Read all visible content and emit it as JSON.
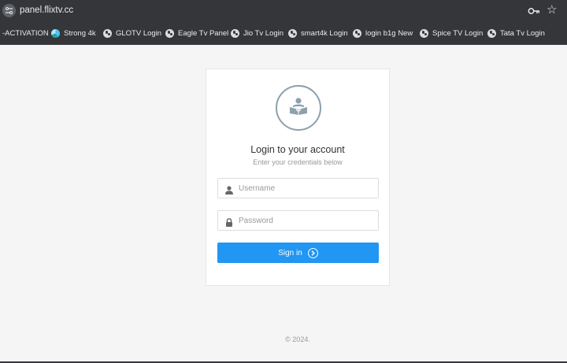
{
  "browser": {
    "url": "panel.flixtv.cc",
    "bookmarks": [
      {
        "label": "-ACTIVATION",
        "icon": "none"
      },
      {
        "label": "Strong 4k",
        "icon": "strong-logo-icon"
      },
      {
        "label": "GLOTV Login",
        "icon": "globe-icon"
      },
      {
        "label": "Eagle Tv Panel",
        "icon": "globe-icon"
      },
      {
        "label": "Jio Tv Login",
        "icon": "globe-icon"
      },
      {
        "label": "smart4k Login",
        "icon": "globe-icon"
      },
      {
        "label": "login b1g New",
        "icon": "globe-icon"
      },
      {
        "label": "Spice TV Login",
        "icon": "globe-icon"
      },
      {
        "label": "Tata Tv Login",
        "icon": "globe-icon"
      }
    ]
  },
  "login": {
    "title": "Login to your account",
    "subtitle": "Enter your credentials below",
    "username_placeholder": "Username",
    "password_placeholder": "Password",
    "signin_label": "Sign in"
  },
  "footer": {
    "copyright": "© 2024."
  },
  "colors": {
    "accent": "#2196f3",
    "chrome": "#35363a",
    "page_bg": "#f5f5f5"
  }
}
